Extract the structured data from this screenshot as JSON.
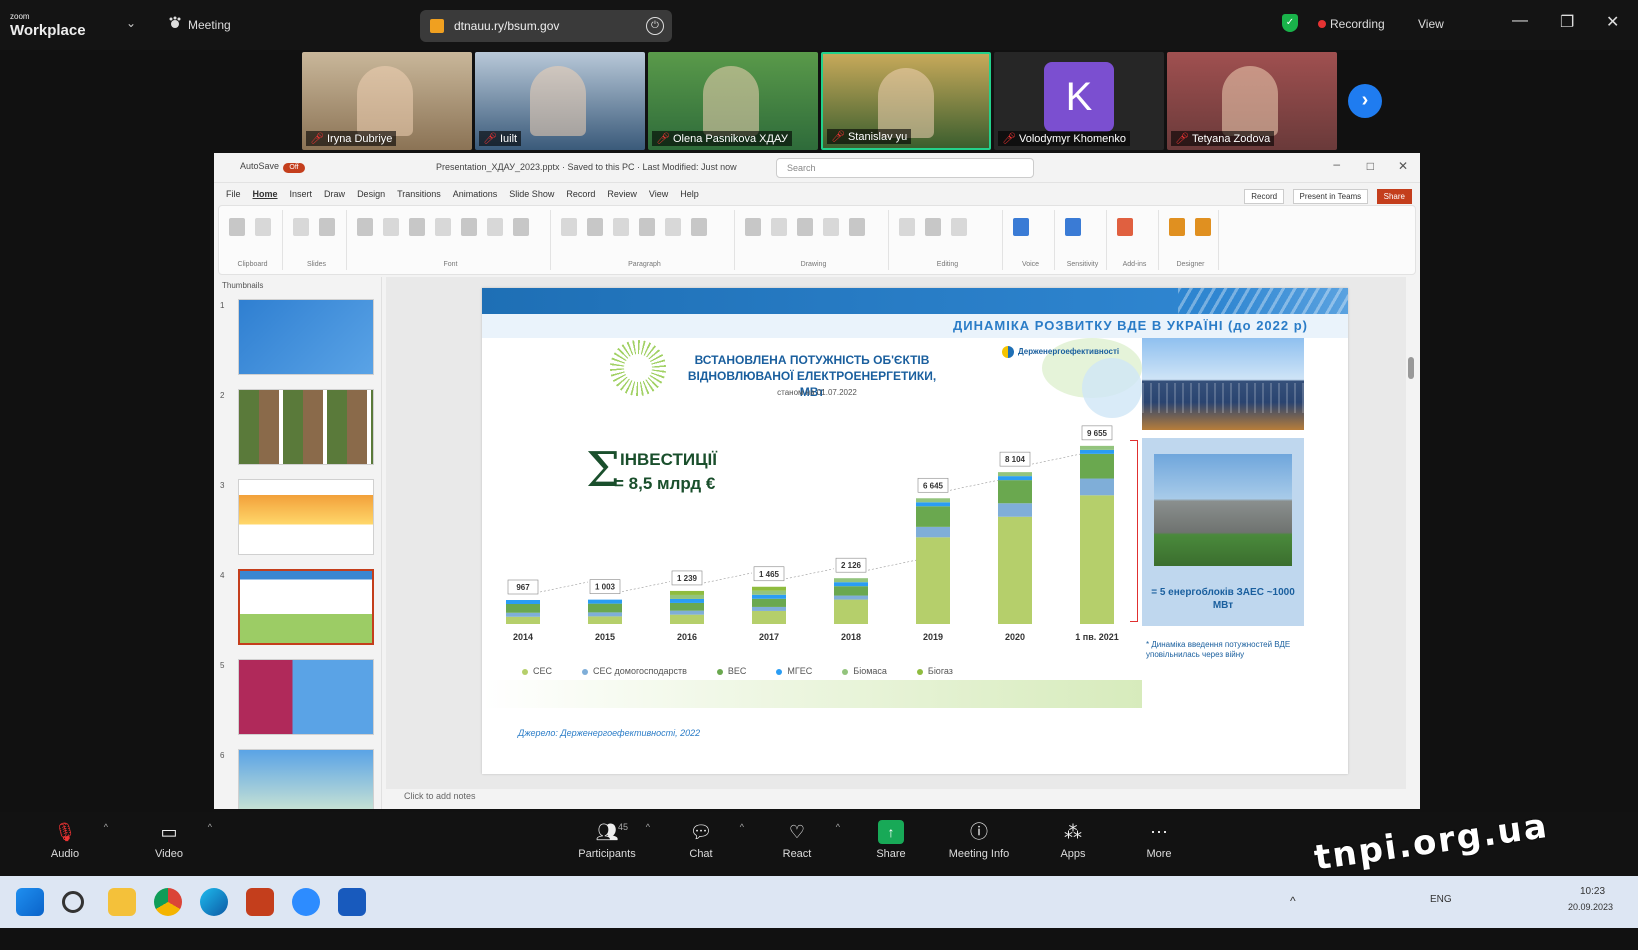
{
  "app": {
    "logo_line1": "zoom",
    "logo_line2": "Workplace",
    "meeting_label": "Meeting",
    "url": "dtnauu.ry/bsum.gov",
    "recording": "Recording",
    "view": "View"
  },
  "participants": [
    {
      "name": "Iryna Dubriye",
      "color": "#8b7355",
      "bg": "#c9b79a"
    },
    {
      "name": "Iuilt",
      "color": "#3a5a7a",
      "bg": "#b8c8d8"
    },
    {
      "name": "Olena Pasnikova ХДАУ",
      "color": "#2e6b3a",
      "bg": "#5a9a4a"
    },
    {
      "name": "Stanislav yu",
      "color": "#3b5e2e",
      "bg": "#c7a95a"
    },
    {
      "name": "Volodymyr Khomenko",
      "initial": "K",
      "color": "#7b4fd0",
      "bg": "#262626"
    },
    {
      "name": "Tetyana Zodova",
      "color": "#6a3a3a",
      "bg": "#a05050"
    }
  ],
  "ppt": {
    "autosave": "AutoSave",
    "toggle": "Off",
    "filename": "Presentation_ХДАУ_2023.pptx · Saved to this PC · Last Modified: Just now",
    "search": "Search",
    "menu": [
      "File",
      "Home",
      "Insert",
      "Draw",
      "Design",
      "Transitions",
      "Animations",
      "Slide Show",
      "Record",
      "Review",
      "View",
      "Help"
    ],
    "menu_active": 1,
    "btn_record": "Record",
    "btn_present": "Present in Teams",
    "btn_share": "Share",
    "ribbon_groups": [
      "Clipboard",
      "Slides",
      "Font",
      "Paragraph",
      "Drawing",
      "Editing",
      "Voice",
      "Sensitivity",
      "Add-ins",
      "Designer"
    ],
    "notes": "Click to add notes",
    "slide_numbers": [
      "1",
      "2",
      "3",
      "4",
      "5",
      "6"
    ],
    "thumbs_label": "Thumbnails"
  },
  "slide": {
    "heading": "ДИНАМІКА РОЗВИТКУ ВДЕ В УКРАЇНІ (до 2022 р)",
    "chart_title": "ВСТАНОВЛЕНА ПОТУЖНІСТЬ ОБ'ЄКТІВ ВІДНОВЛЮВАНОЇ ЕЛЕКТРОЕНЕРГЕТИКИ, МВт",
    "chart_subtitle": "станом на 01.07.2022",
    "org": "Держенергоефективності",
    "sigma": "Σ",
    "inv_line1": "ІНВЕСТИЦІЇ",
    "inv_line2": "= 8,5 млрд €",
    "npp_caption": "= 5 енергоблоків ЗАЕС ~1000 МВт",
    "note": "* Динаміка введення потужностей ВДЕ уповільнилась через війну",
    "footer": "Джерело: Держенергоефективності, 2022"
  },
  "chart_data": {
    "type": "bar",
    "stacked": true,
    "categories": [
      "2014",
      "2015",
      "2016",
      "2017",
      "2018",
      "2019",
      "2020",
      "1 пв. 2021"
    ],
    "totals": [
      "967",
      "1 003",
      "1 239",
      "1 465",
      "2 126",
      "6 645",
      "8 104",
      "9 655"
    ],
    "series": [
      {
        "name": "СЕС",
        "color": "#b5cf6b",
        "values": [
          411,
          432,
          531,
          742,
          1388,
          4925,
          6094,
          7313
        ]
      },
      {
        "name": "СЕС домогосподарств",
        "color": "#7faed8",
        "values": [
          2,
          17,
          38,
          51,
          112,
          594,
          766,
          952
        ]
      },
      {
        "name": "ВЕС",
        "color": "#6aa84f",
        "values": [
          498,
          498,
          438,
          465,
          533,
          1170,
          1314,
          1402
        ]
      },
      {
        "name": "МГЕС",
        "color": "#2a9df4",
        "values": [
          56,
          56,
          59,
          61,
          68,
          92,
          100,
          112
        ]
      },
      {
        "name": "Біомаса",
        "color": "#93c47d",
        "values": [
          0,
          0,
          24,
          35,
          49,
          128,
          124,
          145
        ]
      },
      {
        "name": "Біогаз",
        "color": "#8fbc3f",
        "values": [
          0,
          0,
          149,
          111,
          0,
          0,
          0,
          0
        ]
      }
    ],
    "ylim": [
      0,
      10000
    ]
  },
  "toolbar": [
    {
      "label": "Audio",
      "icon": "microphone-muted-icon"
    },
    {
      "label": "Video",
      "icon": "video-icon"
    },
    {
      "label": "Participants",
      "icon": "participants-icon",
      "count": "45"
    },
    {
      "label": "Chat",
      "icon": "chat-icon"
    },
    {
      "label": "React",
      "icon": "heart-icon"
    },
    {
      "label": "Share",
      "icon": "share-icon"
    },
    {
      "label": "Meeting Info",
      "icon": "info-icon"
    },
    {
      "label": "Apps",
      "icon": "apps-icon"
    },
    {
      "label": "More",
      "icon": "more-icon"
    }
  ],
  "taskbar": {
    "time": "10:23",
    "date": "20.09.2023",
    "lang": "ENG"
  },
  "watermark": "tnpi.org.ua"
}
